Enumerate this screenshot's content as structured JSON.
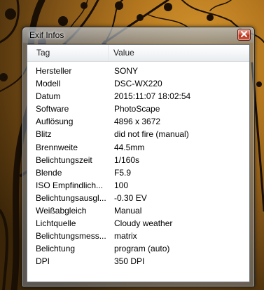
{
  "window": {
    "title": "Exif Infos"
  },
  "columns": {
    "tag": "Tag",
    "value": "Value"
  },
  "rows": [
    {
      "tag": "Hersteller",
      "value": "SONY"
    },
    {
      "tag": "Modell",
      "value": "DSC-WX220"
    },
    {
      "tag": "Datum",
      "value": "2015:11:07 18:02:54"
    },
    {
      "tag": "Software",
      "value": "PhotoScape"
    },
    {
      "tag": "Auflösung",
      "value": "4896 x 3672"
    },
    {
      "tag": "Blitz",
      "value": "did not fire (manual)"
    },
    {
      "tag": "Brennweite",
      "value": "44.5mm"
    },
    {
      "tag": "Belichtungszeit",
      "value": "1/160s"
    },
    {
      "tag": "Blende",
      "value": "F5.9"
    },
    {
      "tag": "ISO Empfindlich...",
      "value": "100"
    },
    {
      "tag": "Belichtungsausgl...",
      "value": "-0.30 EV"
    },
    {
      "tag": "Weißabgleich",
      "value": "Manual"
    },
    {
      "tag": "Lichtquelle",
      "value": "Cloudy weather"
    },
    {
      "tag": "Belichtungsmess...",
      "value": "matrix"
    },
    {
      "tag": "Belichtung",
      "value": "program (auto)"
    },
    {
      "tag": "DPI",
      "value": "350 DPI"
    }
  ]
}
